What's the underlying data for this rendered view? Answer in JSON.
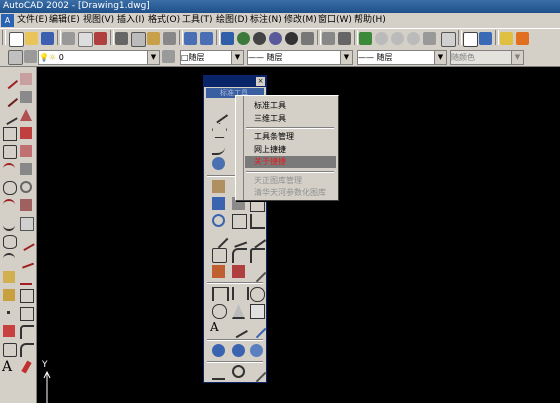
{
  "window": {
    "title": "AutoCAD 2002 - [Drawing1.dwg]"
  },
  "menubar": {
    "items": [
      {
        "label": "文件(E)"
      },
      {
        "label": "编辑(E)"
      },
      {
        "label": "视图(V)"
      },
      {
        "label": "插入(I)"
      },
      {
        "label": "格式(O)"
      },
      {
        "label": "工具(T)"
      },
      {
        "label": "绘图(D)"
      },
      {
        "label": "标注(N)"
      },
      {
        "label": "修改(M)"
      },
      {
        "label": "窗口(W)"
      },
      {
        "label": "帮助(H)"
      }
    ]
  },
  "layerbar": {
    "layer_value": "0",
    "color_value": "□随层",
    "linetype_value": "—— 随层",
    "lineweight_value": "—— 随层",
    "plotstyle_value": "随颜色"
  },
  "floating_toolbar": {
    "title": "标准工具",
    "grip": "标准工具"
  },
  "context_menu": {
    "items": [
      {
        "label": "标准工具",
        "state": "normal"
      },
      {
        "label": "三维工具",
        "state": "normal"
      },
      {
        "label": "工具条管理",
        "state": "normal"
      },
      {
        "label": "网上捷捷",
        "state": "normal"
      },
      {
        "label": "关于捷捷",
        "state": "highlighted"
      },
      {
        "label": "天正图库管理",
        "state": "disabled"
      },
      {
        "label": "清华天河参数化图库",
        "state": "disabled"
      }
    ]
  },
  "ucs": {
    "y_label": "Y"
  },
  "colors": {
    "titlebar": "#1f4f8a",
    "toolbar_bg": "#d4d0c8",
    "canvas": "#000000",
    "highlight": "#7a7a7a",
    "highlight_text": "#e02020"
  }
}
